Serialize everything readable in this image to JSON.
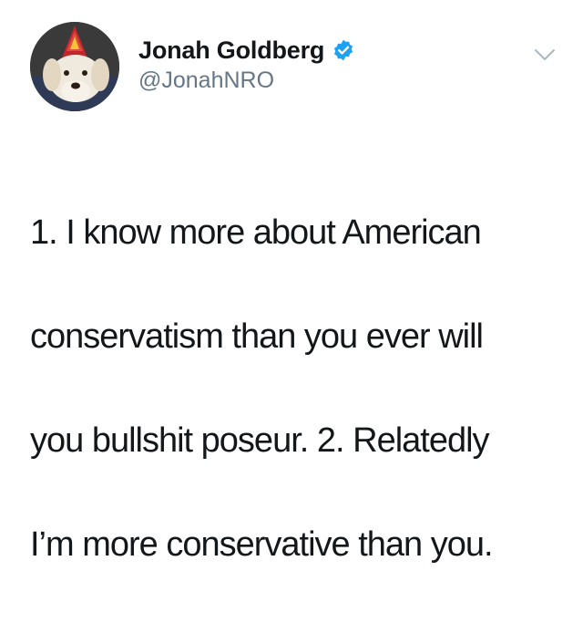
{
  "tweet": {
    "author": {
      "display_name": "Jonah Goldberg",
      "handle": "@JonahNRO",
      "verified": true
    },
    "text_lines": [
      "1. I know more about American",
      "conservatism than you ever will",
      "you bullshit poseur. 2. Relatedly",
      "I’m more conservative than you."
    ]
  },
  "icons": {
    "verified": "verified-badge-icon",
    "menu": "chevron-down-icon"
  },
  "colors": {
    "verified_blue": "#1da1f2",
    "name_text": "#14171a",
    "handle_text": "#657786",
    "chevron": "#aab8c2"
  }
}
